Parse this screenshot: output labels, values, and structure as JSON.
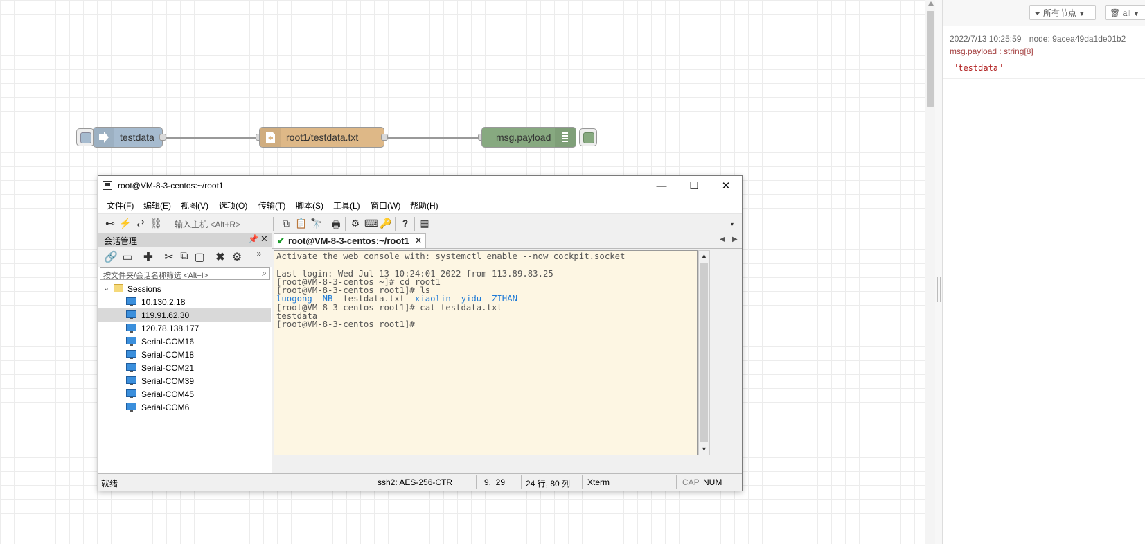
{
  "flow": {
    "inject_label": "testdata",
    "file_label": "root1/testdata.txt",
    "debug_label": "msg.payload"
  },
  "debug_panel": {
    "filter_label": "所有节点",
    "clear_label": "all",
    "message": {
      "timestamp": "2022/7/13 10:25:59",
      "node": "node: 9acea49da1de01b2",
      "topic": "msg.payload : string[8]",
      "value": "\"testdata\""
    }
  },
  "window": {
    "title": "root@VM-8-3-centos:~/root1",
    "menus": [
      "文件(F)",
      "编辑(E)",
      "视图(V)",
      "选项(O)",
      "传输(T)",
      "脚本(S)",
      "工具(L)",
      "窗口(W)",
      "帮助(H)"
    ],
    "host_placeholder": "输入主机 <Alt+R>",
    "session_panel": {
      "title": "会话管理",
      "filter_placeholder": "按文件夹/会话名称筛选 <Alt+I>",
      "root": "Sessions",
      "items": [
        "10.130.2.18",
        "119.91.62.30",
        "120.78.138.177",
        "Serial-COM16",
        "Serial-COM18",
        "Serial-COM21",
        "Serial-COM39",
        "Serial-COM45",
        "Serial-COM6"
      ],
      "selected": "119.91.62.30"
    },
    "tab_label": "root@VM-8-3-centos:~/root1",
    "terminal": {
      "lines": [
        "Activate the web console with: systemctl enable --now cockpit.socket",
        "",
        "Last login: Wed Jul 13 10:24:01 2022 from 113.89.83.25",
        "[root@VM-8-3-centos ~]# cd root1",
        "[root@VM-8-3-centos root1]# ls",
        "__LS__",
        "[root@VM-8-3-centos root1]# cat testdata.txt",
        "testdata",
        "[root@VM-8-3-centos root1]#"
      ],
      "ls_output": [
        {
          "text": "luogong",
          "color": "#1e7ad6"
        },
        {
          "text": "NB",
          "color": "#1e7ad6"
        },
        {
          "text": "testdata.txt",
          "color": "#555555"
        },
        {
          "text": "xiaolin",
          "color": "#1e7ad6"
        },
        {
          "text": "yidu",
          "color": "#1e7ad6"
        },
        {
          "text": "ZIHAN",
          "color": "#1e7ad6"
        }
      ]
    },
    "status": {
      "ready": "就绪",
      "cipher": "ssh2: AES-256-CTR",
      "cursor": "9,  29",
      "size": "24 行, 80 列",
      "term": "Xterm",
      "cap": "CAP",
      "num": "NUM"
    }
  },
  "colors": {
    "inject": "#a6bbcf",
    "file": "#deb887",
    "debug": "#87a980"
  }
}
